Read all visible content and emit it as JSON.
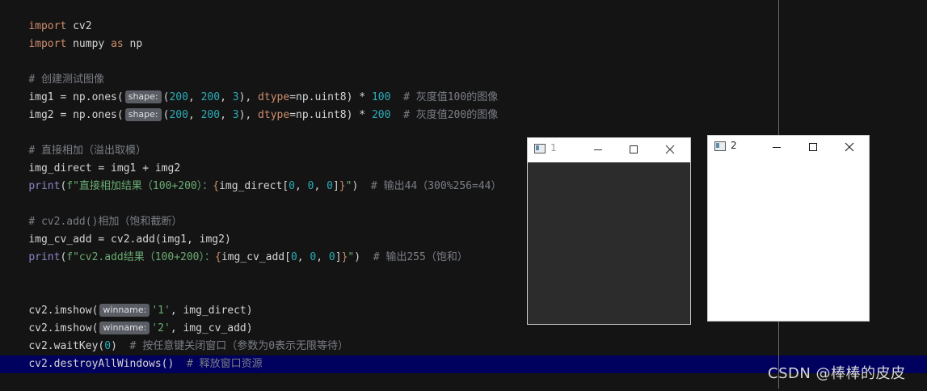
{
  "editor": {
    "lines": {
      "l1": {
        "kw": "import",
        "rest": " cv2"
      },
      "l2": {
        "kw1": "import",
        "mid": " numpy ",
        "kw2": "as",
        "rest": " np"
      },
      "l3": {
        "comment": "# 创建测试图像"
      },
      "l4": {
        "a": "img1 = np.ones(",
        "hint": "shape:",
        "p": "(",
        "n1": "200",
        "c1": ", ",
        "n2": "200",
        "c2": ", ",
        "n3": "3",
        "c3": "), ",
        "param": "dtype",
        "b": "=np.uint8) * ",
        "n4": "100",
        "comment": "  # 灰度值100的图像"
      },
      "l5": {
        "a": "img2 = np.ones(",
        "hint": "shape:",
        "p": "(",
        "n1": "200",
        "c1": ", ",
        "n2": "200",
        "c2": ", ",
        "n3": "3",
        "c3": "), ",
        "param": "dtype",
        "b": "=np.uint8) * ",
        "n4": "200",
        "comment": "  # 灰度值200的图像"
      },
      "l6": {
        "comment": "# 直接相加（溢出取模）"
      },
      "l7": {
        "text": "img_direct = img1 + img2"
      },
      "l8": {
        "fn": "print",
        "p": "(",
        "s1": "f\"直接相加结果（100+200）：",
        "b1": "{",
        "v": "img_direct[",
        "n1": "0",
        "c1": ", ",
        "n2": "0",
        "c2": ", ",
        "n3": "0",
        "v2": "]",
        "b2": "}",
        "s2": "\"",
        "p2": ")",
        "comment": "  # 输出44（300%256=44）"
      },
      "l9": {
        "comment": "# cv2.add()相加（饱和截断）"
      },
      "l10": {
        "text": "img_cv_add = cv2.add(img1, img2)"
      },
      "l11": {
        "fn": "print",
        "p": "(",
        "s1": "f\"cv2.add结果（100+200）：",
        "b1": "{",
        "v": "img_cv_add[",
        "n1": "0",
        "c1": ", ",
        "n2": "0",
        "c2": ", ",
        "n3": "0",
        "v2": "]",
        "b2": "}",
        "s2": "\"",
        "p2": ")",
        "comment": "  # 输出255（饱和）"
      },
      "l12": {
        "a": "cv2.imshow(",
        "hint": "winname:",
        "str": "'1'",
        "b": ", img_direct)"
      },
      "l13": {
        "a": "cv2.imshow(",
        "hint": "winname:",
        "str": "'2'",
        "b": ", img_cv_add)"
      },
      "l14": {
        "a": "cv2.waitKey(",
        "num": "0",
        "b": ")",
        "comment": "  # 按任意键关闭窗口（参数为0表示无限等待）"
      },
      "l15": {
        "a": "cv2.destroyAllWindows()",
        "comment": "  # 释放窗口资源"
      }
    }
  },
  "windows": {
    "w1": {
      "title": "1",
      "fill_color": "#2c2c2c",
      "pixel_value": 44
    },
    "w2": {
      "title": "2",
      "fill_color": "#ffffff",
      "pixel_value": 255
    }
  },
  "watermark": {
    "text": "CSDN @棒棒的皮皮"
  },
  "icons": {
    "window_icon": "opencv-window-icon",
    "minimize": "minimize-icon",
    "maximize": "maximize-icon",
    "close": "close-icon"
  },
  "colors": {
    "background": "#141414",
    "current_line": "#00005f",
    "keyword": "#cf8e6d",
    "number": "#2aacb8",
    "string": "#6aab73",
    "comment": "#7a7e85"
  }
}
